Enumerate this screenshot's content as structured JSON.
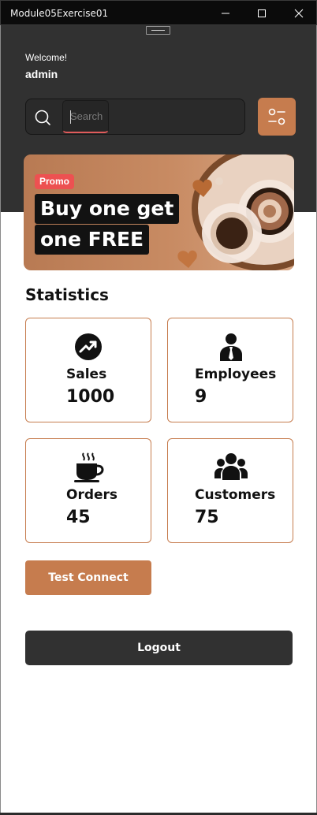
{
  "window": {
    "title": "Module05Exercise01"
  },
  "header": {
    "welcome": "Welcome!",
    "username": "admin"
  },
  "search": {
    "placeholder": "Search",
    "value": ""
  },
  "promo": {
    "badge": "Promo",
    "line1": "Buy one get",
    "line2": "one FREE"
  },
  "statistics": {
    "title": "Statistics",
    "cards": [
      {
        "label": "Sales",
        "value": "1000",
        "icon": "trending-up-icon"
      },
      {
        "label": "Employees",
        "value": "9",
        "icon": "employee-icon"
      },
      {
        "label": "Orders",
        "value": "45",
        "icon": "coffee-cup-icon"
      },
      {
        "label": "Customers",
        "value": "75",
        "icon": "users-group-icon"
      }
    ]
  },
  "buttons": {
    "test_connect": "Test Connect",
    "logout": "Logout"
  },
  "colors": {
    "accent": "#c67c4e",
    "dark": "#313131",
    "promo_badge": "#ed5151"
  }
}
